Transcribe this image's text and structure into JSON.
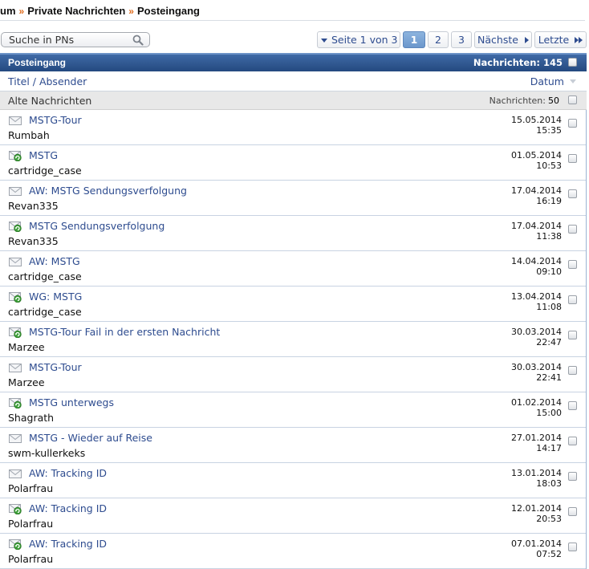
{
  "breadcrumb": {
    "items": [
      "um",
      "Private Nachrichten",
      "Posteingang"
    ],
    "separator": "»"
  },
  "search": {
    "placeholder": "Suche in PNs"
  },
  "pagination": {
    "page_info": "Seite 1 von 3",
    "pages": [
      "1",
      "2",
      "3"
    ],
    "current": "1",
    "next": "Nächste",
    "last": "Letzte"
  },
  "inbox": {
    "title": "Posteingang",
    "count_label": "Nachrichten: 145",
    "col_title": "Titel / Absender",
    "col_date": "Datum",
    "group_label": "Alte Nachrichten",
    "group_count_label": "Nachrichten:",
    "group_count": "50"
  },
  "colors": {
    "header_bg": "#2f5a96",
    "link": "#2e4c8f",
    "accent": "#e06a1a"
  },
  "messages": [
    {
      "title": "MSTG-Tour",
      "sender": "Rumbah",
      "date": "15.05.2014",
      "time": "15:35",
      "icon": "envelope-read-icon"
    },
    {
      "title": "MSTG",
      "sender": "cartridge_case",
      "date": "01.05.2014",
      "time": "10:53",
      "icon": "envelope-replied-icon"
    },
    {
      "title": "AW: MSTG Sendungsverfolgung",
      "sender": "Revan335",
      "date": "17.04.2014",
      "time": "16:19",
      "icon": "envelope-read-icon"
    },
    {
      "title": "MSTG Sendungsverfolgung",
      "sender": "Revan335",
      "date": "17.04.2014",
      "time": "11:38",
      "icon": "envelope-replied-icon"
    },
    {
      "title": "AW: MSTG",
      "sender": "cartridge_case",
      "date": "14.04.2014",
      "time": "09:10",
      "icon": "envelope-read-icon"
    },
    {
      "title": "WG: MSTG",
      "sender": "cartridge_case",
      "date": "13.04.2014",
      "time": "11:08",
      "icon": "envelope-replied-icon"
    },
    {
      "title": "MSTG-Tour Fail in der ersten Nachricht",
      "sender": "Marzee",
      "date": "30.03.2014",
      "time": "22:47",
      "icon": "envelope-replied-icon"
    },
    {
      "title": "MSTG-Tour",
      "sender": "Marzee",
      "date": "30.03.2014",
      "time": "22:41",
      "icon": "envelope-read-icon"
    },
    {
      "title": "MSTG unterwegs",
      "sender": "Shagrath",
      "date": "01.02.2014",
      "time": "15:00",
      "icon": "envelope-replied-icon"
    },
    {
      "title": "MSTG - Wieder auf Reise",
      "sender": "swm-kullerkeks",
      "date": "27.01.2014",
      "time": "14:17",
      "icon": "envelope-read-icon"
    },
    {
      "title": "AW: Tracking ID",
      "sender": "Polarfrau",
      "date": "13.01.2014",
      "time": "18:03",
      "icon": "envelope-read-icon"
    },
    {
      "title": "AW: Tracking ID",
      "sender": "Polarfrau",
      "date": "12.01.2014",
      "time": "20:53",
      "icon": "envelope-replied-icon"
    },
    {
      "title": "AW: Tracking ID",
      "sender": "Polarfrau",
      "date": "07.01.2014",
      "time": "07:52",
      "icon": "envelope-replied-icon"
    }
  ]
}
